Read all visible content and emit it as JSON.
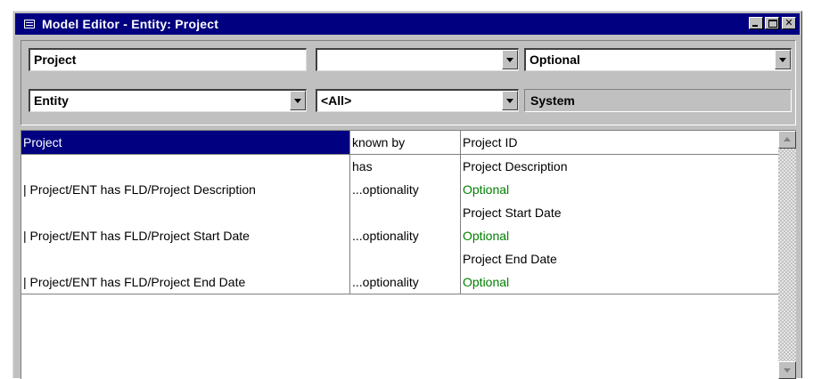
{
  "window": {
    "title": "Model Editor - Entity: Project",
    "icon": "table-window-icon",
    "controls": [
      "minimize",
      "maximize",
      "close"
    ],
    "close_glyph": "✕"
  },
  "header": {
    "name_value": "Project",
    "middle_top_value": "",
    "optionality_value": "Optional",
    "type_value": "Entity",
    "filter_value": "<All>",
    "system_label": "System"
  },
  "grid": {
    "rows": [
      {
        "c1": "Project",
        "c2": "known by",
        "c3": "Project ID",
        "selected": true
      },
      {
        "c1": "",
        "c2": "has",
        "c3": "Project Description"
      },
      {
        "c1": "| Project/ENT has FLD/Project Description",
        "c2": "...optionality",
        "c3": "Optional",
        "c3_green": true
      },
      {
        "c1": "",
        "c2": "",
        "c3": "Project Start Date"
      },
      {
        "c1": "| Project/ENT has FLD/Project Start Date",
        "c2": "...optionality",
        "c3": "Optional",
        "c3_green": true
      },
      {
        "c1": "",
        "c2": "",
        "c3": "Project End Date"
      },
      {
        "c1": "| Project/ENT has FLD/Project End Date",
        "c2": "...optionality",
        "c3": "Optional",
        "c3_green": true
      }
    ]
  },
  "colors": {
    "title_bar": "#000080",
    "selection": "#000080",
    "optional_text": "#008000",
    "face": "#c0c0c0"
  }
}
